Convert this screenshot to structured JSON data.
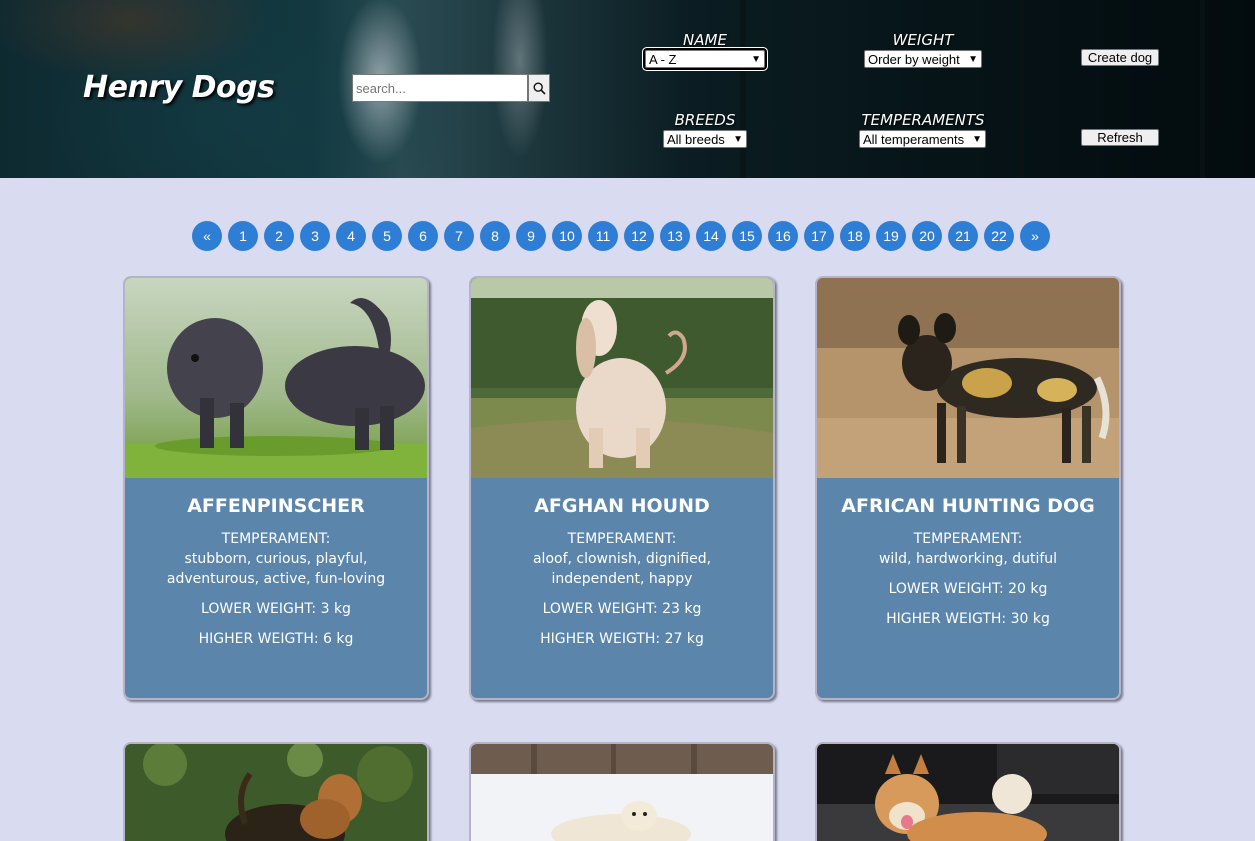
{
  "header": {
    "brand": "Henry Dogs",
    "search": {
      "placeholder": "search...",
      "value": ""
    },
    "filters": {
      "name": {
        "label": "NAME",
        "selected": "A - Z"
      },
      "weight": {
        "label": "WEIGHT",
        "selected": "Order by weight"
      },
      "breeds": {
        "label": "BREEDS",
        "selected": "All breeds"
      },
      "temperaments": {
        "label": "TEMPERAMENTS",
        "selected": "All temperaments"
      }
    },
    "buttons": {
      "create": "Create dog",
      "refresh": "Refresh"
    }
  },
  "pagination": {
    "prev": "«",
    "next": "»",
    "pages": [
      "1",
      "2",
      "3",
      "4",
      "5",
      "6",
      "7",
      "8",
      "9",
      "10",
      "11",
      "12",
      "13",
      "14",
      "15",
      "16",
      "17",
      "18",
      "19",
      "20",
      "21",
      "22"
    ]
  },
  "cards": [
    {
      "name": "AFFENPINSCHER",
      "temperament_label": "TEMPERAMENT:",
      "temperament": "stubborn, curious, playful, adventurous, active, fun-loving",
      "lower_weight": "LOWER WEIGHT: 3 kg",
      "higher_weight": "HIGHER WEIGTH: 6 kg"
    },
    {
      "name": "AFGHAN HOUND",
      "temperament_label": "TEMPERAMENT:",
      "temperament": "aloof, clownish, dignified, independent, happy",
      "lower_weight": "LOWER WEIGHT: 23 kg",
      "higher_weight": "HIGHER WEIGTH: 27 kg"
    },
    {
      "name": "AFRICAN HUNTING DOG",
      "temperament_label": "TEMPERAMENT:",
      "temperament": "wild, hardworking, dutiful",
      "lower_weight": "LOWER WEIGHT: 20 kg",
      "higher_weight": "HIGHER WEIGTH: 30 kg"
    }
  ],
  "colors": {
    "page_bg": "#d9dcf0",
    "card_bg": "#5b85ab",
    "pager_bg": "#2f7ed6"
  }
}
